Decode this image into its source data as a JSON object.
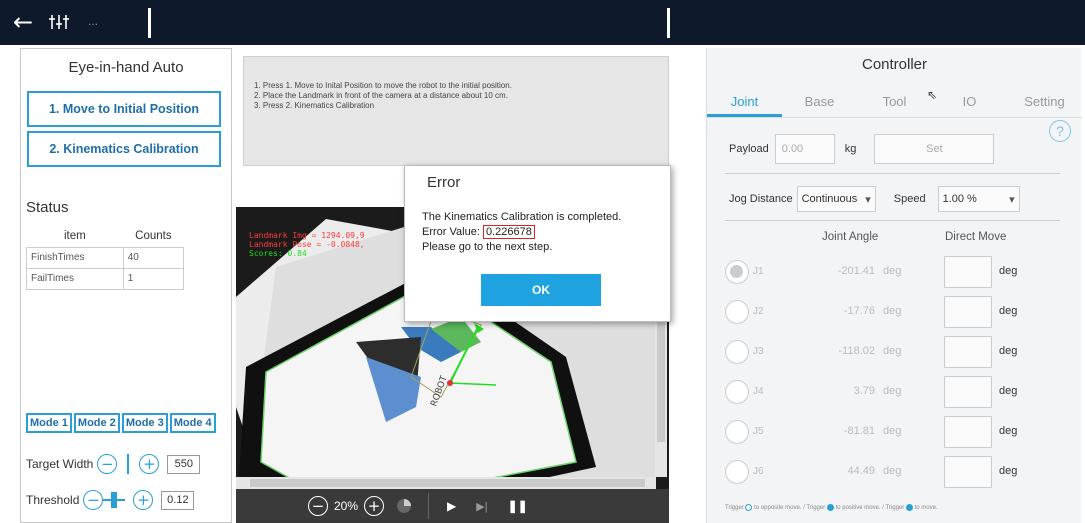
{
  "left_panel": {
    "title": "Eye-in-hand Auto",
    "btn_move": "1. Move to Initial Position",
    "btn_kin": "2. Kinematics Calibration",
    "status_label": "Status",
    "table": {
      "headers": [
        "item",
        "Counts"
      ],
      "rows": [
        [
          "FinishTimes",
          "40"
        ],
        [
          "FailTimes",
          "1"
        ]
      ]
    },
    "modes": [
      "Mode 1",
      "Mode 2",
      "Mode 3",
      "Mode 4"
    ],
    "target_width_label": "Target Width",
    "target_width_value": "550",
    "threshold_label": "Threshold",
    "threshold_value": "0.12"
  },
  "instructions": [
    "1. Press 1. Move to Inital Position to move the robot to the initial position.",
    "2. Place the Landmark in front of the camera at a distance about 10 cm.",
    "3. Press 2. Kinematics Calibration"
  ],
  "camera": {
    "overlay_line1": "Landmark Img   = 1294.09,9",
    "overlay_line2": "Landmark Pose = -0.0848,",
    "overlay_line3": "Scores: 0.84",
    "zoom": "20%"
  },
  "dialog": {
    "title": "Error",
    "line1": "The Kinematics Calibration is completed.",
    "error_label": "Error Value: ",
    "error_value": "0.226678",
    "line3": "Please go to the next step.",
    "ok": "OK"
  },
  "controller": {
    "title": "Controller",
    "tabs": [
      "Joint",
      "Base",
      "Tool",
      "IO",
      "Setting"
    ],
    "payload_label": "Payload",
    "payload_value": "0.00",
    "payload_unit": "kg",
    "set_label": "Set",
    "jog_label": "Jog Distance",
    "jog_value": "Continuous",
    "speed_label": "Speed",
    "speed_value": "1.00 %",
    "col_joint_angle": "Joint Angle",
    "col_direct_move": "Direct Move",
    "joints": [
      {
        "name": "J1",
        "value": "-201.41",
        "unit": "deg"
      },
      {
        "name": "J2",
        "value": "-17.76",
        "unit": "deg"
      },
      {
        "name": "J3",
        "value": "-118.02",
        "unit": "deg"
      },
      {
        "name": "J4",
        "value": "3.79",
        "unit": "deg"
      },
      {
        "name": "J5",
        "value": "-81.81",
        "unit": "deg"
      },
      {
        "name": "J6",
        "value": "44.49",
        "unit": "deg"
      }
    ],
    "footer": {
      "a1": "Trigger",
      "a2": "to opposite move.",
      "sep": "/",
      "b2": "to positive move.",
      "c2": "to move."
    }
  },
  "colors": {
    "accent": "#2a9fd6",
    "topbar": "#0e1a2b",
    "ok_button": "#1fa3e0",
    "error_highlight": "#e02020"
  },
  "icons": [
    "back-arrow-icon",
    "adjust-sliders-icon",
    "more-dots-icon",
    "help-icon",
    "zoom-out-icon",
    "zoom-in-icon",
    "play-icon",
    "step-icon",
    "pause-icon",
    "chevron-down-icon"
  ]
}
